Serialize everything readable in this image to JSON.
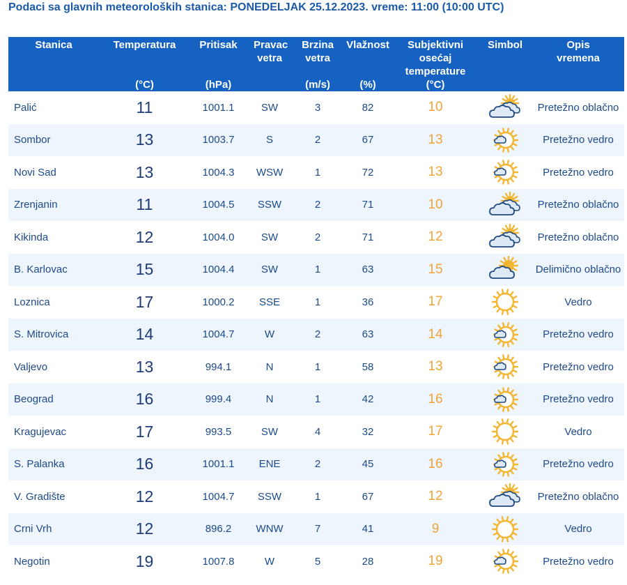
{
  "title": "Podaci sa glavnih meteoroloških stanica:  PONEDELJAK 25.12.2023.  vreme: 11:00 (10:00 UTC)",
  "columns": [
    {
      "label": "Stanica",
      "unit": ""
    },
    {
      "label": "Temperatura",
      "unit": "(°C)"
    },
    {
      "label": "Pritisak",
      "unit": "(hPa)"
    },
    {
      "label": "Pravac vetra",
      "unit": ""
    },
    {
      "label": "Brzina vetra",
      "unit": "(m/s)"
    },
    {
      "label": "Vlažnost",
      "unit": "(%)"
    },
    {
      "label": "Subjektivni osećaj temperature",
      "unit": "(°C)"
    },
    {
      "label": "Simbol",
      "unit": ""
    },
    {
      "label": "Opis vremena",
      "unit": ""
    }
  ],
  "rows": [
    {
      "station": "Palić",
      "temp": "11",
      "pressure": "1001.1",
      "dir": "SW",
      "speed": "3",
      "humidity": "82",
      "feel": "10",
      "icon": "cloudy-sun-icon",
      "desc": "Pretežno oblačno"
    },
    {
      "station": "Sombor",
      "temp": "13",
      "pressure": "1003.7",
      "dir": "S",
      "speed": "2",
      "humidity": "67",
      "feel": "13",
      "icon": "sun-small-cloud-icon",
      "desc": "Pretežno vedro"
    },
    {
      "station": "Novi Sad",
      "temp": "13",
      "pressure": "1004.3",
      "dir": "WSW",
      "speed": "1",
      "humidity": "72",
      "feel": "13",
      "icon": "sun-small-cloud-icon",
      "desc": "Pretežno vedro"
    },
    {
      "station": "Zrenjanin",
      "temp": "11",
      "pressure": "1004.5",
      "dir": "SSW",
      "speed": "2",
      "humidity": "71",
      "feel": "10",
      "icon": "cloudy-sun-icon",
      "desc": "Pretežno oblačno"
    },
    {
      "station": "Kikinda",
      "temp": "12",
      "pressure": "1004.0",
      "dir": "SW",
      "speed": "2",
      "humidity": "71",
      "feel": "12",
      "icon": "cloudy-sun-icon",
      "desc": "Pretežno oblačno"
    },
    {
      "station": "B. Karlovac",
      "temp": "15",
      "pressure": "1004.4",
      "dir": "SW",
      "speed": "1",
      "humidity": "63",
      "feel": "15",
      "icon": "partly-cloudy-icon",
      "desc": "Delimično oblačno"
    },
    {
      "station": "Loznica",
      "temp": "17",
      "pressure": "1000.2",
      "dir": "SSE",
      "speed": "1",
      "humidity": "36",
      "feel": "17",
      "icon": "sun-icon",
      "desc": "Vedro"
    },
    {
      "station": "S. Mitrovica",
      "temp": "14",
      "pressure": "1004.7",
      "dir": "W",
      "speed": "2",
      "humidity": "63",
      "feel": "14",
      "icon": "sun-small-cloud-icon",
      "desc": "Pretežno vedro"
    },
    {
      "station": "Valjevo",
      "temp": "13",
      "pressure": "994.1",
      "dir": "N",
      "speed": "1",
      "humidity": "58",
      "feel": "13",
      "icon": "sun-small-cloud-icon",
      "desc": "Pretežno vedro"
    },
    {
      "station": "Beograd",
      "temp": "16",
      "pressure": "999.4",
      "dir": "N",
      "speed": "1",
      "humidity": "42",
      "feel": "16",
      "icon": "sun-small-cloud-icon",
      "desc": "Pretežno vedro"
    },
    {
      "station": "Kragujevac",
      "temp": "17",
      "pressure": "993.5",
      "dir": "SW",
      "speed": "4",
      "humidity": "32",
      "feel": "17",
      "icon": "sun-icon",
      "desc": "Vedro"
    },
    {
      "station": "S. Palanka",
      "temp": "16",
      "pressure": "1001.1",
      "dir": "ENE",
      "speed": "2",
      "humidity": "45",
      "feel": "16",
      "icon": "sun-small-cloud-icon",
      "desc": "Pretežno vedro"
    },
    {
      "station": "V. Gradište",
      "temp": "12",
      "pressure": "1004.7",
      "dir": "SSW",
      "speed": "1",
      "humidity": "67",
      "feel": "12",
      "icon": "cloudy-sun-icon",
      "desc": "Pretežno oblačno"
    },
    {
      "station": "Crni Vrh",
      "temp": "12",
      "pressure": "896.2",
      "dir": "WNW",
      "speed": "7",
      "humidity": "41",
      "feel": "9",
      "icon": "sun-icon",
      "desc": "Vedro"
    },
    {
      "station": "Negotin",
      "temp": "19",
      "pressure": "1007.8",
      "dir": "W",
      "speed": "5",
      "humidity": "28",
      "feel": "19",
      "icon": "sun-small-cloud-icon",
      "desc": "Pretežno vedro"
    }
  ],
  "colors": {
    "header_bg": "#1662c2",
    "title": "#1a5aa8",
    "row_alt": "#eef5fd",
    "feel": "#f0a43a",
    "sun": "#f3b632",
    "cloud_fill": "#dfe9f5",
    "cloud_stroke": "#1d4a80"
  }
}
